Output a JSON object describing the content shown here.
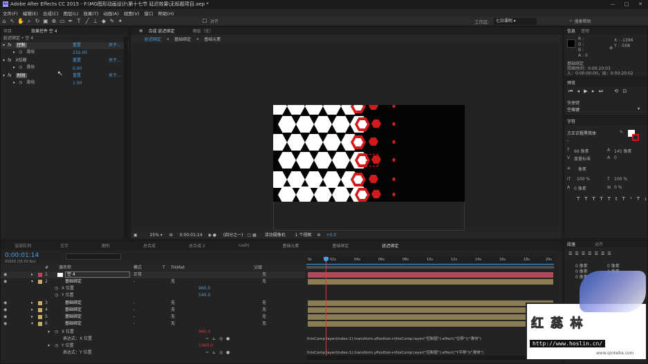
{
  "titlebar": {
    "text": "Adobe After Effects CC 2015 - F:\\MG图形动画设计\\第十七节 延迟效果\\无标题项目.aep *"
  },
  "menu": [
    "文件(F)",
    "编辑(E)",
    "合成(C)",
    "图层(L)",
    "效果(T)",
    "动画(A)",
    "视图(V)",
    "窗口",
    "帮助(H)"
  ],
  "toolbar": {
    "snap_label": "对齐",
    "workspace_label": "工作区:",
    "workspace_value": "七日课明",
    "search_label": "搜索帮助"
  },
  "effects_panel": {
    "tab_project": "项目",
    "tab_effects": "效果控件 空 4",
    "header": "延迟绑定 • 空 4",
    "effects": [
      {
        "name": "控制",
        "reset": "重置",
        "about": "关于...",
        "prop": "滑块",
        "value": "232.00"
      },
      {
        "name": "X位移",
        "reset": "重置",
        "about": "关于...",
        "prop": "滑块",
        "value": "0.00"
      },
      {
        "name": "时间",
        "reset": "重置",
        "about": "关于...",
        "prop": "滑块",
        "value": "1.50"
      }
    ]
  },
  "comp_panel": {
    "tab_comp": "合成 延迟绑定",
    "tab_layer": "图层（无）",
    "breadcrumbs": [
      "延迟绑定",
      "基础绑定",
      "基础元素"
    ],
    "zoom": "25%",
    "time": "0:00:01:14",
    "resolution": "(四分之一)",
    "camera": "活动摄像机",
    "views": "1 个视图",
    "exposure": "+0.0"
  },
  "info_panel": {
    "tab_info": "信息",
    "tab_audio": "音频",
    "r": "R :",
    "g": "G :",
    "b": "B :",
    "a": "A : 0",
    "x": "X : -1396",
    "y": "Y : -508",
    "layer_name": "基础绑定",
    "duration": "持续时间：0:00:20:03",
    "inout": "入：0:00:00:00，出：0:00:20:02"
  },
  "preview_panel": {
    "tab": "预览",
    "shortcut_label": "快捷键",
    "shortcut_value": "空格键"
  },
  "character_panel": {
    "tab": "字符",
    "font": "方正正粗黑简体",
    "dash": "-",
    "size": "66 像素",
    "leading": "145 像素",
    "tracking_label": "度量标准",
    "tracking": "0",
    "stroke": "像素",
    "scale_v": "100 %",
    "scale_h": "100 %",
    "baseline": "0 像素",
    "tsume": "0 %"
  },
  "paragraph_panel": {
    "tab_para": "段落",
    "tab_align": "对齐",
    "indent": [
      "0 像素",
      "0 像素",
      "0 像素",
      "0 像素",
      "0 像素"
    ]
  },
  "timeline": {
    "tabs": [
      "渲染队列",
      "文字",
      "图形",
      "总合成",
      "总合成 2",
      "cashi",
      "基础元素",
      "基础绑定",
      "延迟绑定"
    ],
    "current_time": "0:00:01:14",
    "fps": "00039 (25.00 fps)",
    "headers": {
      "num": "#",
      "name": "源名称",
      "mode": "模式",
      "t": "T",
      "trkmat": "TrkMat",
      "parent": "父级"
    },
    "ruler": [
      "0s",
      "02s",
      "04s",
      "06s",
      "08s",
      "10s",
      "12s",
      "14s",
      "16s",
      "18s",
      "20s"
    ],
    "layers": [
      {
        "num": "1",
        "name": "空 4",
        "mode": "正常",
        "trk": "",
        "parent": "无",
        "color": "#c0455c",
        "bar": "#b04a5a"
      },
      {
        "num": "2",
        "name": "基础绑定",
        "mode": "-",
        "trk": "无",
        "parent": "无",
        "color": "#c9b060",
        "bar": "#8a7d55"
      },
      {
        "sub": "X 位置",
        "value": "960.0"
      },
      {
        "sub": "Y 位置",
        "value": "540.0"
      },
      {
        "num": "3",
        "name": "基础绑定",
        "mode": "-",
        "trk": "无",
        "parent": "无",
        "color": "#c9b060",
        "bar": "#8a7d55"
      },
      {
        "num": "4",
        "name": "基础绑定",
        "mode": "-",
        "trk": "无",
        "parent": "无",
        "color": "#c9b060",
        "bar": "#8a7d55"
      },
      {
        "num": "5",
        "name": "基础绑定",
        "mode": "-",
        "trk": "无",
        "parent": "无",
        "color": "#c9b060",
        "bar": "#8a7d55"
      },
      {
        "num": "6",
        "name": "基础绑定",
        "mode": "-",
        "trk": "无",
        "parent": "无",
        "color": "#c9b060",
        "bar": "#8a7d55"
      }
    ],
    "x_pos": {
      "label": "X 位置",
      "value": "960.0",
      "expr_label": "表达式：X 位置",
      "expr": "thisComp.layer(index-1).transform.xPosition+thisComp.layer(\"控制层\").effect(\"位移\")(\"滑块\")"
    },
    "y_pos": {
      "label": "Y 位置",
      "value": "1460.0",
      "expr_label": "表达式：Y 位置",
      "expr": "thisComp.layer(index-1).transform.yPosition+thisComp.layer(\"控制层\").effect(\"Y平移\")(\"滑块\")"
    }
  },
  "watermark": {
    "line1": "红 蕊 林",
    "url": "http://www.hoslin.cn/",
    "url2": "www.qinkeba.com"
  },
  "colors": {
    "accent": "#4c9fe0",
    "hex_red": "#d21a1a",
    "timeline_cursor": "#d63a3a"
  }
}
